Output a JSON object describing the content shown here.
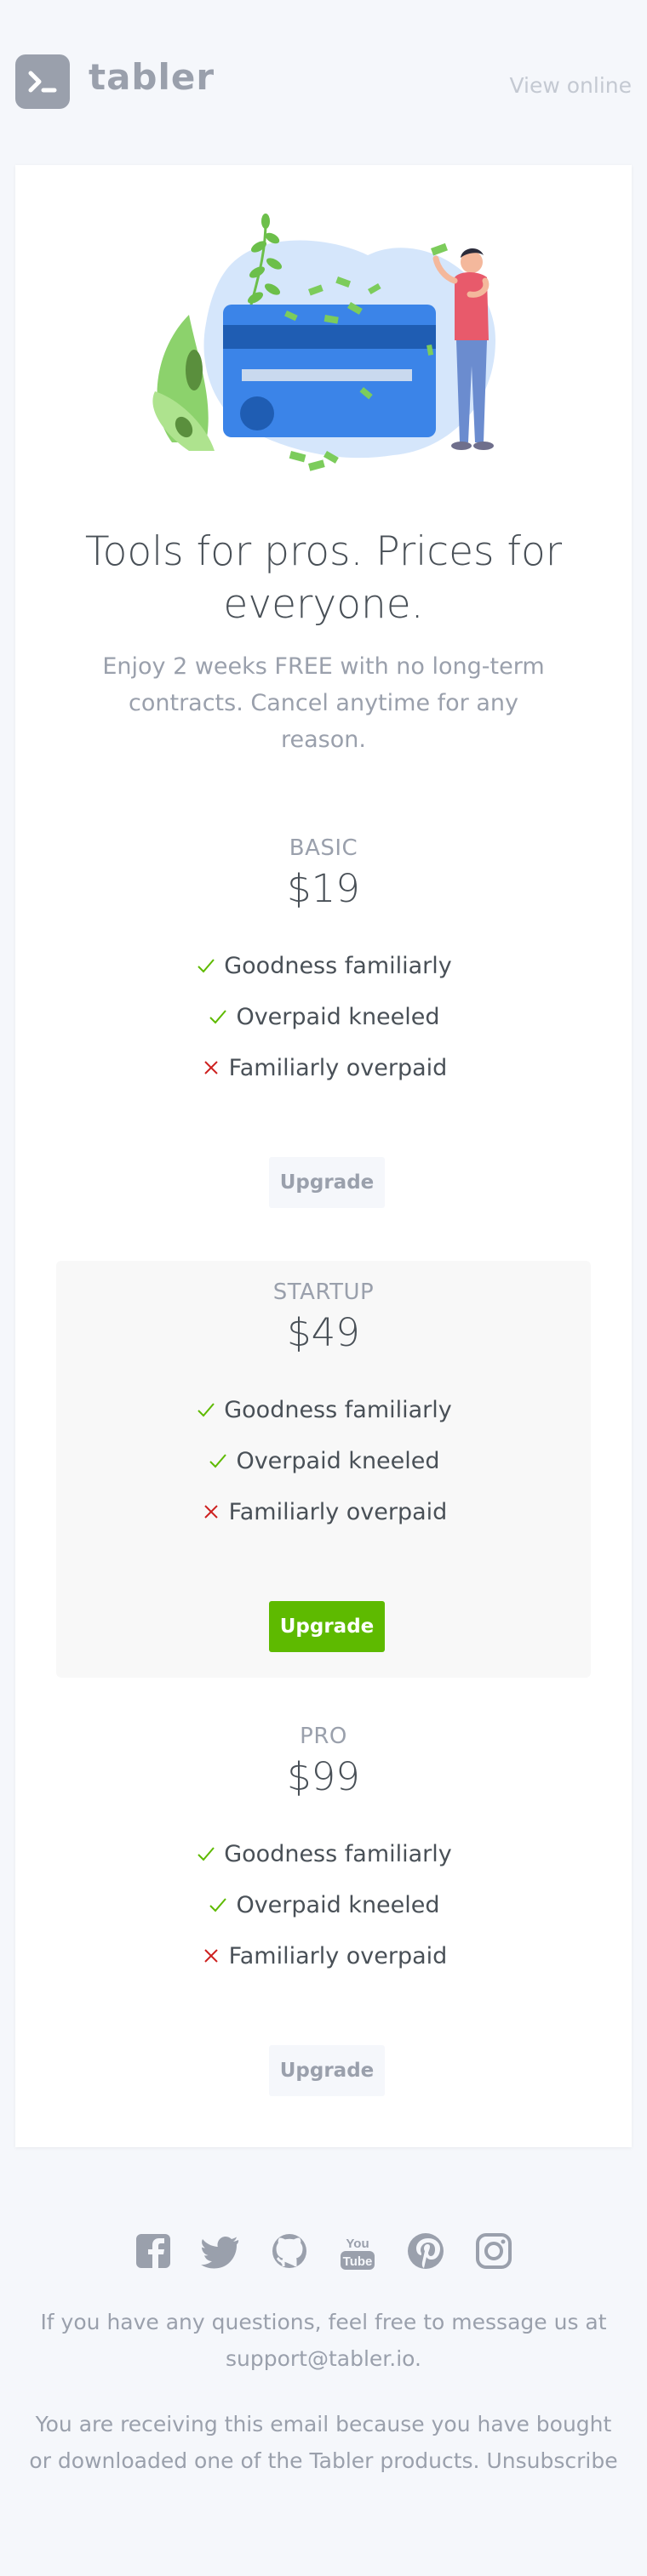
{
  "header": {
    "brand": "tabler",
    "view_online": "View online"
  },
  "hero": {
    "headline": "Tools for pros. Prices for everyone.",
    "subline": "Enjoy 2 weeks FREE with no long-term contracts. Cancel anytime for any reason."
  },
  "plans": [
    {
      "name": "BASIC",
      "price": "$19",
      "features": [
        {
          "label": "Goodness familiarly",
          "included": true
        },
        {
          "label": "Overpaid kneeled",
          "included": true
        },
        {
          "label": "Familiarly overpaid",
          "included": false
        }
      ],
      "button": "Upgrade",
      "featured": false
    },
    {
      "name": "STARTUP",
      "price": "$49",
      "features": [
        {
          "label": "Goodness familiarly",
          "included": true
        },
        {
          "label": "Overpaid kneeled",
          "included": true
        },
        {
          "label": "Familiarly overpaid",
          "included": false
        }
      ],
      "button": "Upgrade",
      "featured": true
    },
    {
      "name": "PRO",
      "price": "$99",
      "features": [
        {
          "label": "Goodness familiarly",
          "included": true
        },
        {
          "label": "Overpaid kneeled",
          "included": true
        },
        {
          "label": "Familiarly overpaid",
          "included": false
        }
      ],
      "button": "Upgrade",
      "featured": false
    }
  ],
  "footer": {
    "social_icons": [
      "facebook-icon",
      "twitter-icon",
      "github-icon",
      "youtube-icon",
      "pinterest-icon",
      "instagram-icon"
    ],
    "questions_text": "If you have any questions, feel free to message us at",
    "support_email": "support@tabler.io.",
    "receiving_text": "You are receiving this email because you have bought or downloaded one of the Tabler products.",
    "unsubscribe": "Unsubscribe"
  },
  "colors": {
    "background": "#f5f7fb",
    "muted": "#9aa0ac",
    "primary_button": "#5eba00",
    "check": "#5eba00",
    "cross": "#cd201f"
  }
}
